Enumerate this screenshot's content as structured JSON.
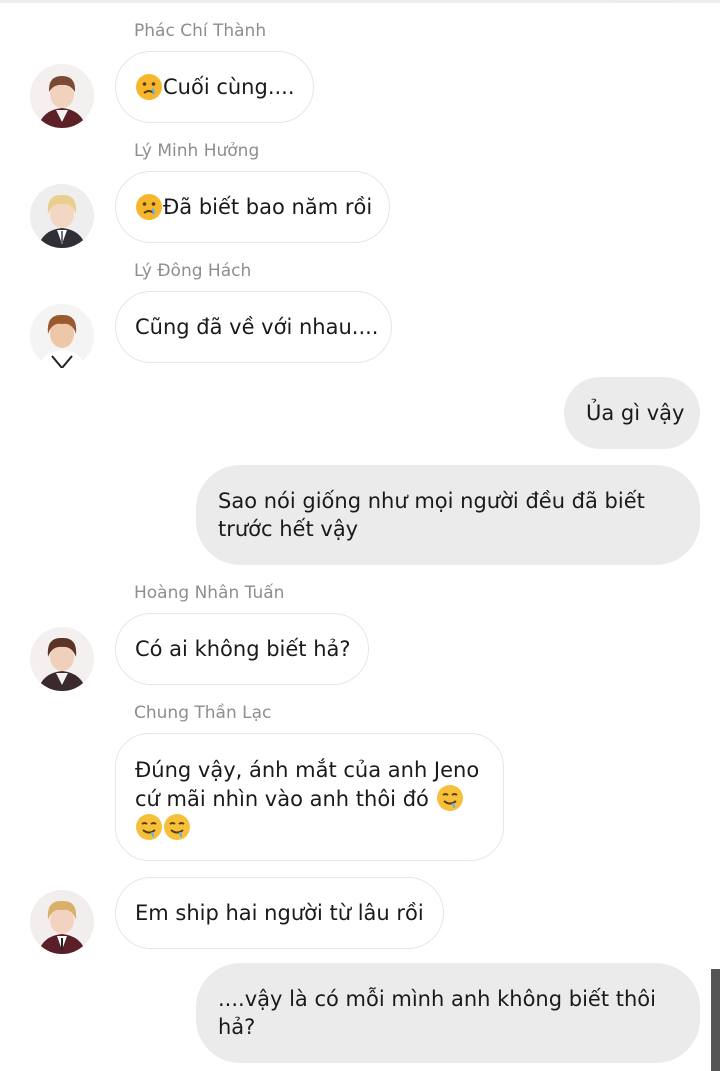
{
  "messages": [
    {
      "sender": "Phác Chí Thành",
      "text": "Cuối cùng....",
      "emoji": "crying-face-icon"
    },
    {
      "sender": "Lý Minh Hưởng",
      "text": "Đã biết bao năm rồi",
      "emoji": "crying-face-icon"
    },
    {
      "sender": "Lý Đông Hách",
      "text": "Cũng đã về với nhau...."
    },
    {
      "outgoing": true,
      "text": "Ủa gì vậy"
    },
    {
      "outgoing": true,
      "lines": [
        "Sao nói giống như mọi người đều đã biết",
        "trước hết vậy"
      ]
    },
    {
      "sender": "Hoàng Nhân Tuấn",
      "text": "Có ai không biết hả?"
    },
    {
      "sender": "Chung Thần Lạc",
      "lines": [
        "Đúng vậy, ánh mắt của anh Jeno",
        "cứ mãi nhìn vào anh thôi đó"
      ],
      "emojis": [
        "drooling-face-icon",
        "drooling-face-icon",
        "drooling-face-icon"
      ]
    },
    {
      "text": "Em ship hai người từ lâu rồi"
    },
    {
      "outgoing": true,
      "lines": [
        "....vậy là có mỗi mình anh không biết thôi",
        "hả?"
      ]
    }
  ],
  "colors": {
    "outgoing_bubble": "#ebebeb",
    "incoming_border": "#e6e6e6",
    "sender_name": "#8e8e8e"
  }
}
